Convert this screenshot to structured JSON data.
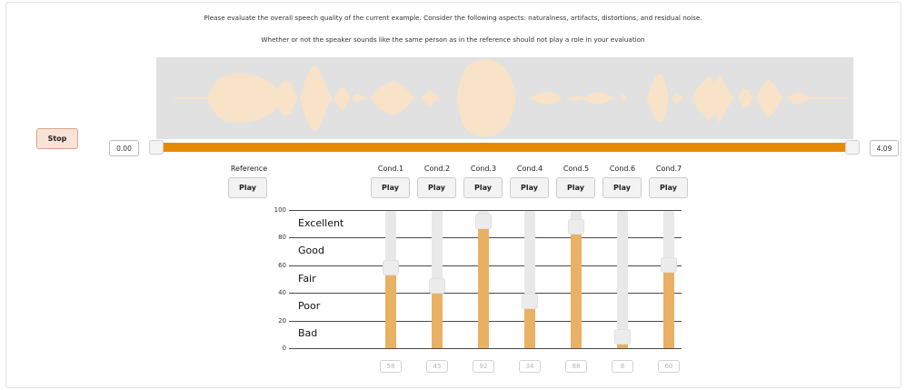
{
  "instructions": {
    "line1": "Please evaluate the overall speech quality of the current example. Consider the following aspects: naturalness, artifacts, distortions, and residual noise.",
    "line2": "Whether or not the speaker sounds like the same person as in the reference should not play a role in your evaluation"
  },
  "player": {
    "stop_label": "Stop",
    "time_start": "0.00",
    "time_end": "4.09",
    "progress": 1.0
  },
  "reference": {
    "label": "Reference",
    "play_label": "Play"
  },
  "conditions": [
    {
      "label": "Cond.1",
      "play_label": "Play",
      "value": "58"
    },
    {
      "label": "Cond.2",
      "play_label": "Play",
      "value": "45"
    },
    {
      "label": "Cond.3",
      "play_label": "Play",
      "value": "92"
    },
    {
      "label": "Cond.4",
      "play_label": "Play",
      "value": "34"
    },
    {
      "label": "Cond.5",
      "play_label": "Play",
      "value": "88"
    },
    {
      "label": "Cond.6",
      "play_label": "Play",
      "value": "8"
    },
    {
      "label": "Cond.7",
      "play_label": "Play",
      "value": "60"
    }
  ],
  "scale": {
    "ticks": [
      "100",
      "80",
      "60",
      "40",
      "20",
      "0"
    ],
    "grades": [
      "Excellent",
      "Good",
      "Fair",
      "Poor",
      "Bad"
    ]
  },
  "colors": {
    "accent": "#e88a00",
    "fill": "#e9b163",
    "waveform": "#f8e3c9",
    "stop_button": "#f9e2d6"
  }
}
